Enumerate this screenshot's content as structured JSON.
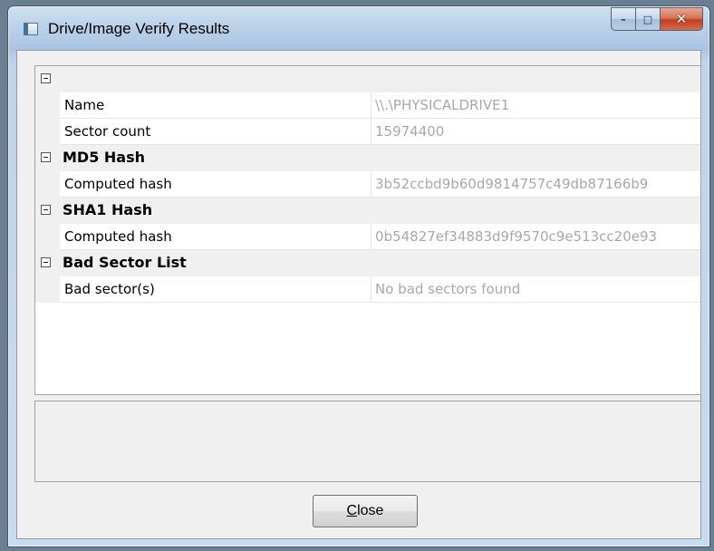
{
  "window": {
    "title": "Drive/Image Verify Results",
    "controls": {
      "minimize": "–",
      "maximize": "□",
      "close": "✕"
    }
  },
  "properties": {
    "sections": [
      {
        "title": "",
        "rows": [
          {
            "name": "Name",
            "value": "\\\\.\\PHYSICALDRIVE1"
          },
          {
            "name": "Sector count",
            "value": "15974400"
          }
        ]
      },
      {
        "title": "MD5 Hash",
        "rows": [
          {
            "name": "Computed hash",
            "value": "3b52ccbd9b60d9814757c49db87166b9"
          }
        ]
      },
      {
        "title": "SHA1 Hash",
        "rows": [
          {
            "name": "Computed hash",
            "value": "0b54827ef34883d9f9570c9e513cc20e93"
          }
        ]
      },
      {
        "title": "Bad Sector List",
        "rows": [
          {
            "name": "Bad sector(s)",
            "value": "No bad sectors found"
          }
        ]
      }
    ]
  },
  "buttons": {
    "close_mnemonic": "C",
    "close_rest": "lose"
  }
}
